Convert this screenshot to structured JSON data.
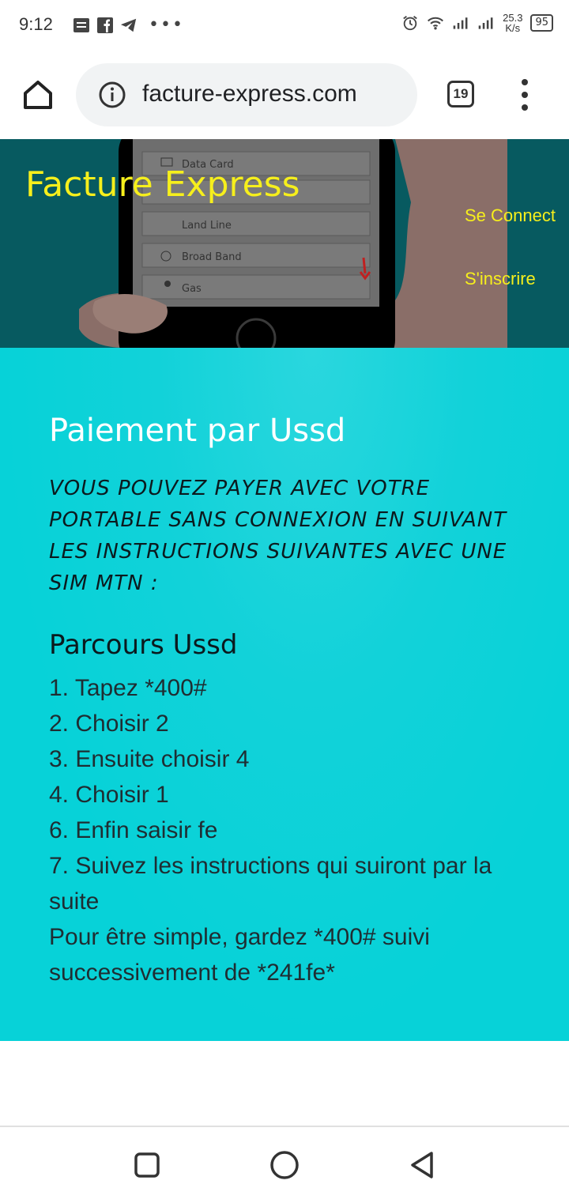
{
  "status_bar": {
    "time": "9:12",
    "net_speed_value": "25.3",
    "net_speed_unit": "K/s",
    "battery": "95",
    "icons": [
      "notes-icon",
      "facebook-icon",
      "telegram-icon",
      "more-dots-icon",
      "alarm-icon",
      "wifi-icon",
      "signal-icon",
      "signal-icon",
      "battery-icon"
    ]
  },
  "browser": {
    "url": "facture-express.com",
    "tab_count": "19"
  },
  "header": {
    "site_title": "Facture Express",
    "login_link": "Se Connect",
    "signup_link": "S'inscrire",
    "hero_phone_items": [
      "Data Card",
      "Land Line",
      "Broad Band",
      "Gas"
    ]
  },
  "main": {
    "title": "Paiement par Ussd",
    "intro": "VOUS POUVEZ PAYER AVEC VOTRE PORTABLE SANS CONNEXION EN SUIVANT LES INSTRUCTIONS SUIVANTES AVEC UNE SIM MTN :",
    "route_title": "Parcours Ussd",
    "steps": [
      "1. Tapez *400#",
      "2. Choisir 2",
      "3. Ensuite choisir 4",
      "4. Choisir 1",
      "6. Enfin saisir fe",
      "7. Suivez les instructions qui suiront par la suite",
      "Pour être simple, gardez *400# suivi successivement de *241fe*"
    ]
  },
  "colors": {
    "header_bg": "#075a60",
    "accent_yellow": "#f6ef1c",
    "main_bg": "#07d2d8"
  }
}
